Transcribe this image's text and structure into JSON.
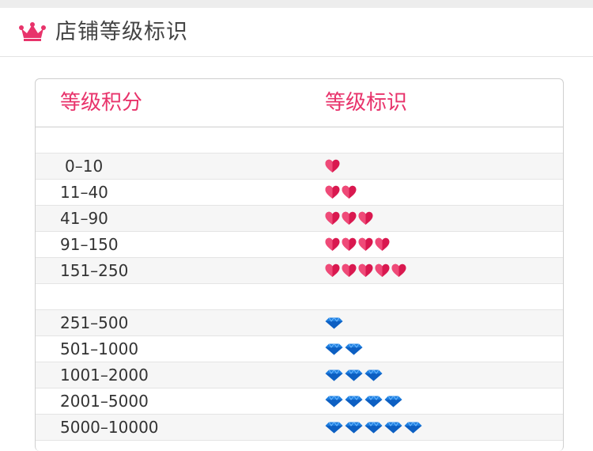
{
  "header": {
    "icon": "crown-icon",
    "title": "店铺等级标识"
  },
  "table": {
    "columns": [
      "等级积分",
      "等级标识"
    ],
    "groups": [
      {
        "icon": "heart-icon",
        "rows": [
          {
            "range": "0–10",
            "count": 1
          },
          {
            "range": "11–40",
            "count": 2
          },
          {
            "range": "41–90",
            "count": 3
          },
          {
            "range": "91–150",
            "count": 4
          },
          {
            "range": "151–250",
            "count": 5
          }
        ]
      },
      {
        "icon": "diamond-icon",
        "rows": [
          {
            "range": "251–500",
            "count": 1
          },
          {
            "range": "501–1000",
            "count": 2
          },
          {
            "range": "1001–2000",
            "count": 3
          },
          {
            "range": "2001–5000",
            "count": 4
          },
          {
            "range": "5000–10000",
            "count": 5
          }
        ]
      }
    ]
  },
  "colors": {
    "accent": "#e8336b",
    "heart": "#d9184f",
    "diamond": "#1e88e5"
  }
}
